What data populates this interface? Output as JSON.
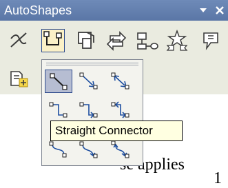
{
  "window": {
    "title": "AutoShapes",
    "title_bar_color": "#5f7cac",
    "toolbar_bg_color": "#eaebe0"
  },
  "toolbar": {
    "buttons": [
      {
        "icon": "lines-icon"
      },
      {
        "icon": "connectors-icon",
        "pressed": true
      },
      {
        "icon": "basic-shapes-icon"
      },
      {
        "icon": "block-arrows-icon"
      },
      {
        "icon": "flowchart-icon"
      },
      {
        "icon": "stars-and-banners-icon"
      },
      {
        "icon": "callouts-icon"
      }
    ],
    "row2_button_icon": "more-autoshapes-icon"
  },
  "connectors_menu": {
    "items": [
      {
        "icon": "straight-connector-icon",
        "selected": true
      },
      {
        "icon": "straight-arrow-connector-icon"
      },
      {
        "icon": "straight-double-arrow-connector-icon"
      },
      {
        "icon": "elbow-connector-icon"
      },
      {
        "icon": "elbow-arrow-connector-icon"
      },
      {
        "icon": "elbow-double-arrow-connector-icon"
      },
      {
        "icon": "curved-connector-icon"
      },
      {
        "icon": "curved-arrow-connector-icon"
      },
      {
        "icon": "curved-double-arrow-connector-icon"
      }
    ]
  },
  "tooltip": {
    "text": "Straight Connector",
    "bg_color": "#ffffe1"
  },
  "document": {
    "text_line1": "se applies",
    "text_line2": "1"
  }
}
